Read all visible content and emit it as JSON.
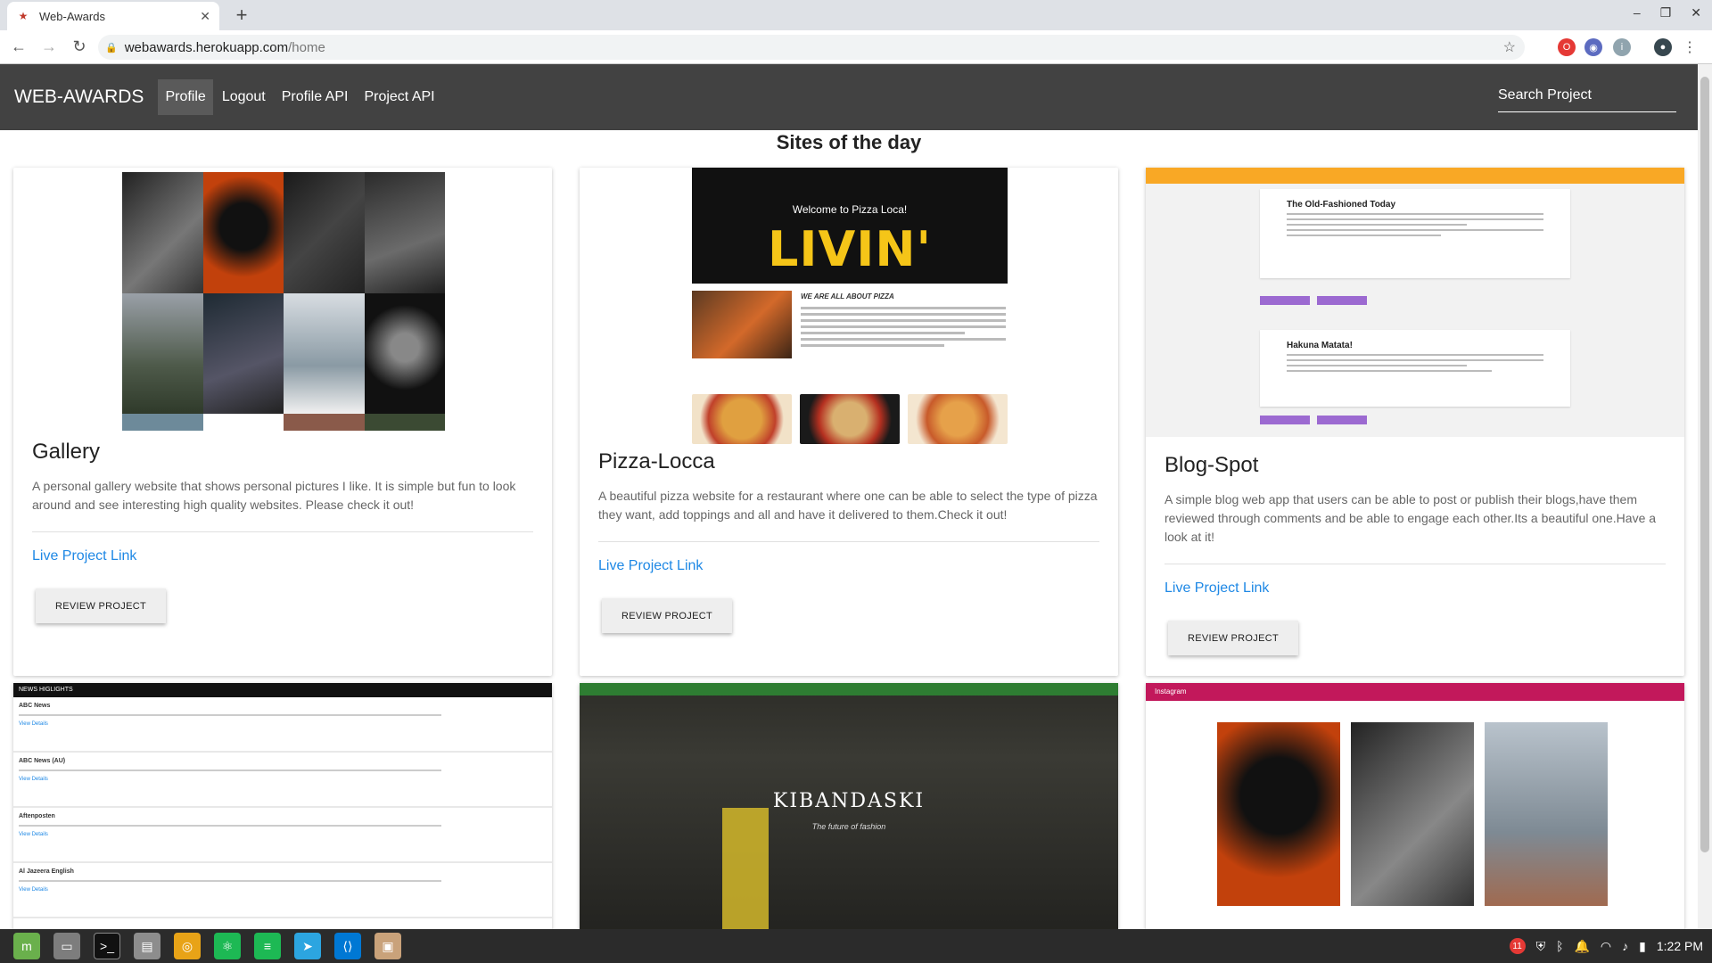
{
  "browser": {
    "tab_title": "Web-Awards",
    "url_host": "webawards.herokuapp.com",
    "url_path": "/home"
  },
  "nav": {
    "brand": "WEB-AWARDS",
    "links": [
      "Profile",
      "Logout",
      "Profile API",
      "Project API"
    ],
    "active": "Profile",
    "search_placeholder": "Search Project"
  },
  "page": {
    "heading": "Sites of the day"
  },
  "cards": [
    {
      "title": "Gallery",
      "description": "A personal gallery website that shows personal pictures I like. It is simple but fun to look around and see interesting high quality websites. Please check it out!",
      "link": "Live Project Link",
      "button": "REVIEW PROJECT"
    },
    {
      "title": "Pizza-Locca",
      "description": "A beautiful pizza website for a restaurant where one can be able to select the type of pizza they want, add toppings and all and have it delivered to them.Check it out!",
      "link": "Live Project Link",
      "button": "REVIEW PROJECT",
      "thumb_welcome": "Welcome to Pizza Loca!",
      "thumb_hero": "LIVIN'",
      "thumb_about": "WE ARE ALL ABOUT PIZZA"
    },
    {
      "title": "Blog-Spot",
      "description": "A simple blog web app that users can be able to post or publish their blogs,have them reviewed through comments and be able to engage each other.Its a beautiful one.Have a look at it!",
      "link": "Live Project Link",
      "button": "REVIEW PROJECT",
      "thumb_post1": "The Old-Fashioned Today",
      "thumb_post2": "Hakuna Matata!"
    }
  ],
  "lower_cards": {
    "news_bar": "NEWS HIGLIGHTS",
    "news_items": [
      "ABC News",
      "ABC News (AU)",
      "Aftenposten",
      "Al Jazeera English"
    ],
    "news_view": "View Details",
    "kiban_title": "KIBANDASKI",
    "kiban_sub": "The future of fashion",
    "insta_brand": "Instagram"
  },
  "taskbar": {
    "time": "1:22 PM",
    "badge": "11"
  },
  "colors": {
    "navbar": "#424242",
    "link": "#1e88e5",
    "blog_bar": "#f9a825",
    "insta_bar": "#c2185b",
    "kiban_bar": "#2e7d32"
  }
}
